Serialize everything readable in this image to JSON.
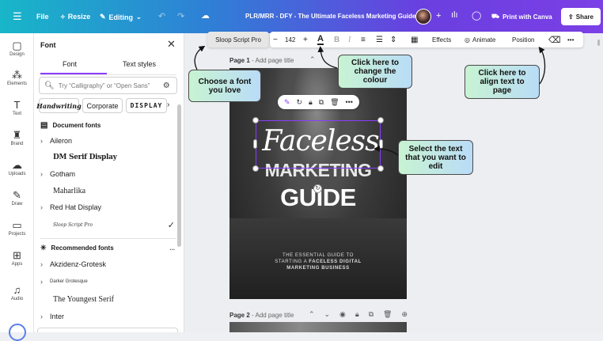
{
  "topbar": {
    "menu_icon": "menu-icon",
    "file": "File",
    "resize": "Resize",
    "editing": "Editing",
    "title": "PLR/MRR - DFY - The Ultimate Faceless Marketing Guide",
    "print_label": "Print with Canva",
    "share_label": "Share"
  },
  "sidebar": {
    "items": [
      {
        "label": "Design",
        "icon": "design-icon"
      },
      {
        "label": "Elements",
        "icon": "elements-icon"
      },
      {
        "label": "Text",
        "icon": "text-icon"
      },
      {
        "label": "Brand",
        "icon": "brand-icon"
      },
      {
        "label": "Uploads",
        "icon": "uploads-icon"
      },
      {
        "label": "Draw",
        "icon": "draw-icon"
      },
      {
        "label": "Projects",
        "icon": "projects-icon"
      },
      {
        "label": "Apps",
        "icon": "apps-icon"
      },
      {
        "label": "Audio",
        "icon": "audio-icon"
      }
    ]
  },
  "font_panel": {
    "title": "Font",
    "tabs": [
      "Font",
      "Text styles"
    ],
    "search_placeholder": "Try “Calligraphy” or “Open Sans”",
    "chips": [
      "Handwriting",
      "Corporate",
      "DISPLAY"
    ],
    "document_fonts_heading": "Document fonts",
    "document_fonts": [
      {
        "name": "Aileron",
        "expandable": true
      },
      {
        "name": "DM Serif Display",
        "expandable": false
      },
      {
        "name": "Gotham",
        "expandable": true
      },
      {
        "name": "Maharlika",
        "expandable": false
      },
      {
        "name": "Red Hat Display",
        "expandable": true
      },
      {
        "name": "Sloop Script Pro",
        "expandable": false,
        "selected": true
      }
    ],
    "recommended_heading": "Recommended fonts",
    "recommended_more": "...",
    "recommended_fonts": [
      {
        "name": "Akzidenz-Grotesk",
        "expandable": true
      },
      {
        "name": "Darker Grotesque",
        "expandable": true
      },
      {
        "name": "The Youngest Serif",
        "expandable": false
      },
      {
        "name": "Inter",
        "expandable": true
      }
    ]
  },
  "text_toolbar": {
    "font_name": "Sloop Script Pro",
    "size_minus": "−",
    "font_size": "142",
    "size_plus": "+",
    "color_letter": "A",
    "bold": "B",
    "italic": "I",
    "effects": "Effects",
    "animate": "Animate",
    "position": "Position",
    "more": "•••"
  },
  "page1": {
    "label": "Page 1",
    "title_placeholder": "- Add page title",
    "script_word": "Faceless",
    "word2": "MARKETING",
    "word3": "GUIDE",
    "sub1": "THE ESSENTIAL GUIDE TO",
    "sub2_a": "STARTING A ",
    "sub2_b": "FACELESS DIGITAL",
    "sub3": "MARKETING BUSINESS"
  },
  "page2": {
    "label": "Page 2",
    "title_placeholder": "- Add page title"
  },
  "callouts": {
    "choose_font": "Choose a font you love",
    "change_colour": "Click here to change the colour",
    "align_text": "Click here to align text to page",
    "select_text": "Select the text that you want to edit"
  },
  "colors": {
    "topbar_start": "#18b6c9",
    "topbar_end": "#7b3fe6",
    "selection": "#8b3dff"
  }
}
